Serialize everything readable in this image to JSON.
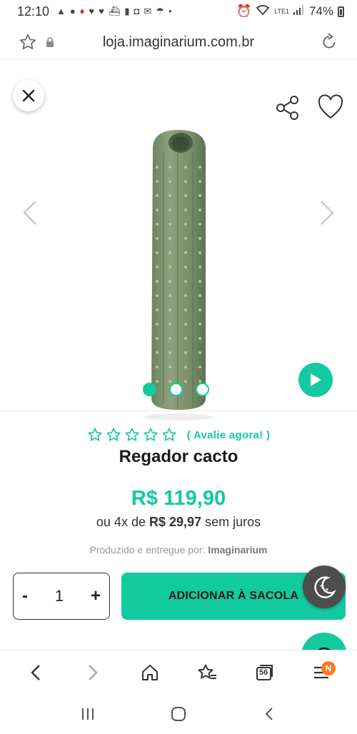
{
  "status_bar": {
    "time": "12:10",
    "battery": "74%",
    "network": "LTE1"
  },
  "browser": {
    "url": "loja.imaginarium.com.br",
    "tabs_count": "56",
    "menu_badge": "N"
  },
  "gallery": {
    "image_alt": "Regador cacto",
    "slide_count": 3,
    "active_slide": 1
  },
  "product": {
    "rating_label": "( Avalie agora! )",
    "title": "Regador cacto",
    "price": "R$ 119,90",
    "installments_prefix": "ou 4x de",
    "installment_value": "R$ 29,97",
    "installments_suffix": "sem juros",
    "seller_prefix": "Produzido e entregue por:",
    "seller_name": "Imaginarium"
  },
  "purchase": {
    "quantity": "1",
    "minus_label": "-",
    "plus_label": "+",
    "add_to_bag_label": "ADICIONAR À SACOLA"
  },
  "colors": {
    "accent": "#12c9a0",
    "product_green": "#7f9670"
  }
}
